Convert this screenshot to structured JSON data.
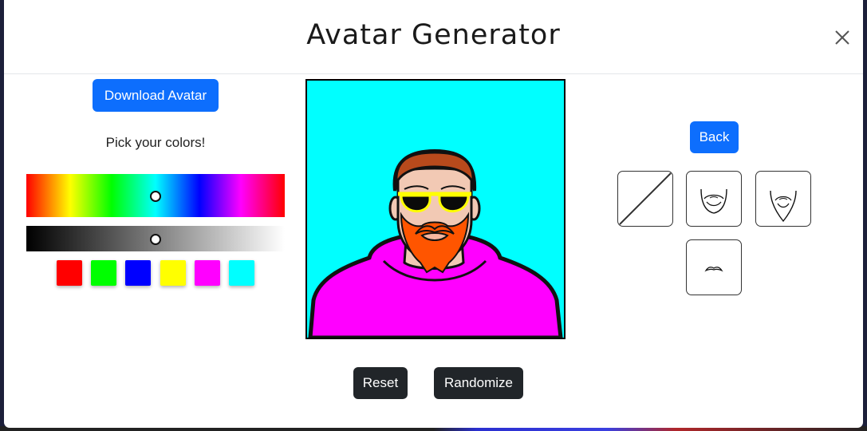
{
  "modal": {
    "title": "Avatar Generator",
    "close_icon": "close-icon"
  },
  "left_panel": {
    "download_label": "Download Avatar",
    "pick_label": "Pick your colors!",
    "hue_slider_value": 0.5,
    "shade_slider_value": 0.5,
    "swatches": [
      {
        "name": "red",
        "color": "#ff0000"
      },
      {
        "name": "green",
        "color": "#00ff00"
      },
      {
        "name": "blue",
        "color": "#0000ff"
      },
      {
        "name": "yellow",
        "color": "#ffff00"
      },
      {
        "name": "magenta",
        "color": "#ff00ff"
      },
      {
        "name": "cyan",
        "color": "#00ffff"
      }
    ]
  },
  "avatar": {
    "background_color": "#00ffff",
    "hoodie_color": "#ff00ff",
    "beard_color": "#ff5500",
    "hair_color": "#b84a1c",
    "glasses_frame_color": "#ffff00",
    "skin_color": "#f2c9b4"
  },
  "right_panel": {
    "back_label": "Back",
    "options": [
      {
        "name": "no-facial-hair",
        "icon": "none-icon",
        "selected": true
      },
      {
        "name": "full-beard",
        "icon": "full-beard-icon",
        "selected": false
      },
      {
        "name": "pointed-beard",
        "icon": "pointed-beard-icon",
        "selected": false
      },
      {
        "name": "mustache",
        "icon": "mustache-icon",
        "selected": false
      }
    ]
  },
  "footer": {
    "reset_label": "Reset",
    "randomize_label": "Randomize"
  },
  "colors": {
    "primary": "#0d6efd",
    "dark": "#212529"
  }
}
